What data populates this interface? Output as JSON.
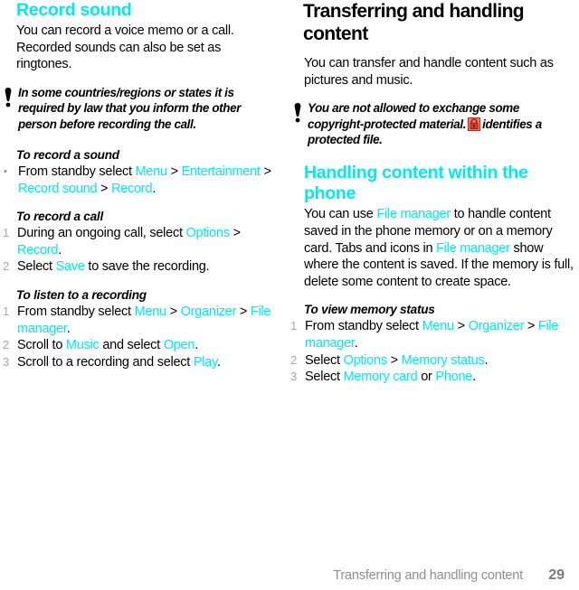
{
  "document": {
    "footer": {
      "title": "Transferring and handling content",
      "page_number": "29"
    }
  },
  "left_column": {
    "heading": "Record sound",
    "intro": "You can record a voice memo or a call. Recorded sounds can also be set as ringtones.",
    "note": "In some countries/regions or states it is required by law that you inform the other person before recording the call.",
    "proc1": {
      "title": "To record a sound",
      "marker": "•",
      "step1": {
        "a": "From standby select ",
        "link1": "Menu",
        "b": " > ",
        "link2": "Entertainment",
        "c": " > ",
        "link3": "Record sound",
        "d": " > ",
        "link4": "Record",
        "e": "."
      }
    },
    "proc2": {
      "title": "To record a call",
      "steps": [
        {
          "marker": "1",
          "a": "During an ongoing call, select ",
          "link1": "Options",
          "b": " > ",
          "link2": "Record",
          "c": "."
        },
        {
          "marker": "2",
          "a": "Select ",
          "link1": "Save",
          "b": " to save the recording."
        }
      ]
    },
    "proc3": {
      "title": "To listen to a recording",
      "steps": [
        {
          "marker": "1",
          "a": "From standby select ",
          "link1": "Menu",
          "b": " > ",
          "link2": "Organizer",
          "c": " > ",
          "link3": "File manager",
          "d": "."
        },
        {
          "marker": "2",
          "a": "Scroll to ",
          "link1": "Music",
          "b": " and select ",
          "link2": "Open",
          "c": "."
        },
        {
          "marker": "3",
          "a": "Scroll to a recording and select ",
          "link1": "Play",
          "b": "."
        }
      ]
    }
  },
  "right_column": {
    "heading": "Transferring and handling content",
    "intro": "You can transfer and handle content such as pictures and music.",
    "note": {
      "part1": "You are not allowed to exchange some copyright-protected material.",
      "icon_name": "lock-icon",
      "part2": "identifies a protected file."
    },
    "subheading": "Handling content within the phone",
    "body": {
      "a": "You can use ",
      "link1": "File manager",
      "b": " to handle content saved in the phone memory or on a memory card. Tabs and icons in ",
      "link2": "File manager",
      "c": " show where the content is saved. If the memory is full, delete some content to create space."
    },
    "proc": {
      "title": "To view memory status",
      "steps": [
        {
          "marker": "1",
          "a": "From standby select ",
          "link1": "Menu",
          "b": " > ",
          "link2": "Organizer",
          "c": " > ",
          "link3": "File manager",
          "d": "."
        },
        {
          "marker": "2",
          "a": "Select ",
          "link1": "Options",
          "b": " > ",
          "link2": "Memory status",
          "c": "."
        },
        {
          "marker": "3",
          "a": "Select ",
          "link1": "Memory card",
          "b": " or ",
          "link2": "Phone",
          "c": "."
        }
      ]
    }
  },
  "colors": {
    "link_cyan": "#00e8f0",
    "marker_gray": "#a8a8a8",
    "footer_gray": "#8e8e8e",
    "lock_red": "#d93b2b"
  }
}
